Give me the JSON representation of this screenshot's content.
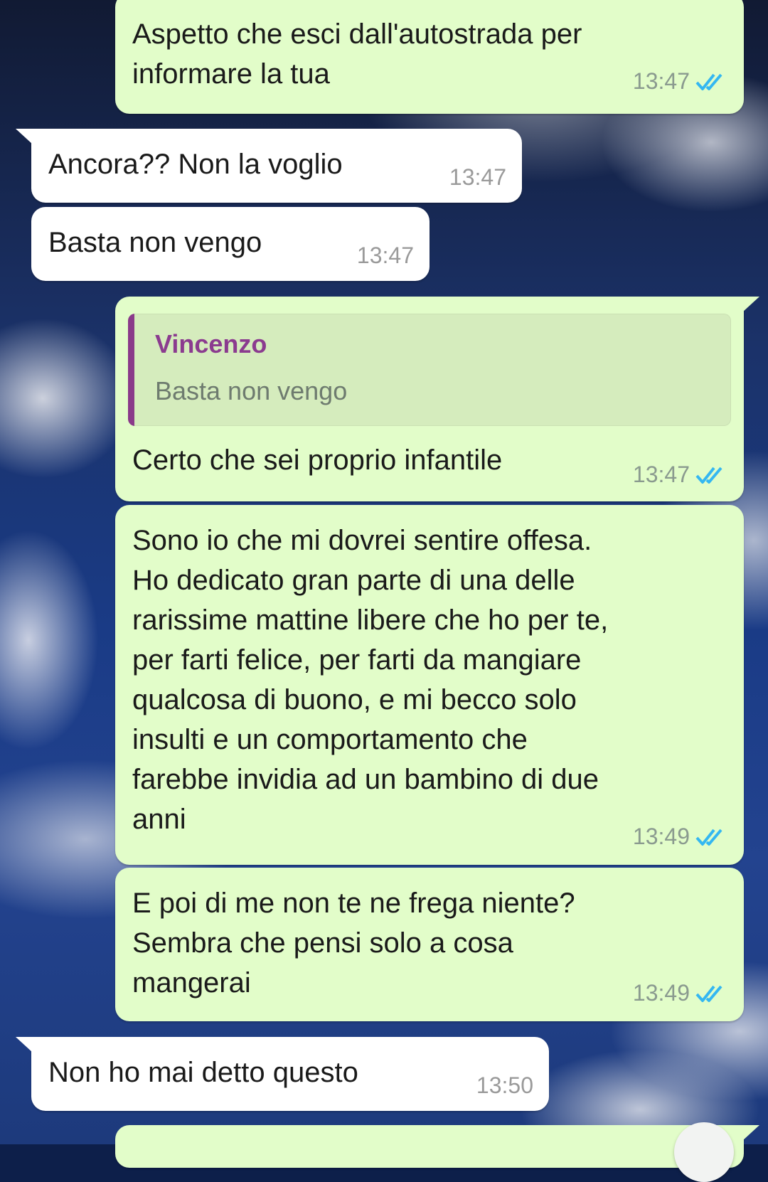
{
  "messages": [
    {
      "id": 1,
      "direction": "outgoing",
      "text": "Aspetto che esci dall'autostrada per\ninformare la tua",
      "time": "13:47",
      "status": "read"
    },
    {
      "id": 2,
      "direction": "incoming",
      "text": "Ancora?? Non la voglio",
      "time": "13:47"
    },
    {
      "id": 3,
      "direction": "incoming",
      "text": "Basta non vengo",
      "time": "13:47"
    },
    {
      "id": 4,
      "direction": "outgoing",
      "reply_to": {
        "author": "Vincenzo",
        "text": "Basta non vengo"
      },
      "text": "Certo che sei proprio infantile",
      "time": "13:47",
      "status": "read"
    },
    {
      "id": 5,
      "direction": "outgoing",
      "text": "Sono io che mi dovrei sentire offesa.\nHo dedicato gran parte di una delle\nrarissime mattine libere che ho per te,\nper farti felice, per farti da mangiare\nqualcosa di buono, e mi becco solo\ninsulti e un comportamento che\nfarebbe invidia ad un bambino di due\nanni",
      "time": "13:49",
      "status": "read"
    },
    {
      "id": 6,
      "direction": "outgoing",
      "text": "E poi di me non te ne frega niente?\nSembra che pensi solo a cosa\nmangerai",
      "time": "13:49",
      "status": "read"
    },
    {
      "id": 7,
      "direction": "incoming",
      "text": "Non ho mai detto questo",
      "time": "13:50"
    }
  ],
  "colors": {
    "outgoing_bubble": "#e2fdc9",
    "incoming_bubble": "#ffffff",
    "read_check": "#34b7f1",
    "quote_author": "#8b3b8f",
    "quote_bar": "#8a3a8a"
  },
  "icons": {
    "read_receipt": "double-check-icon"
  }
}
